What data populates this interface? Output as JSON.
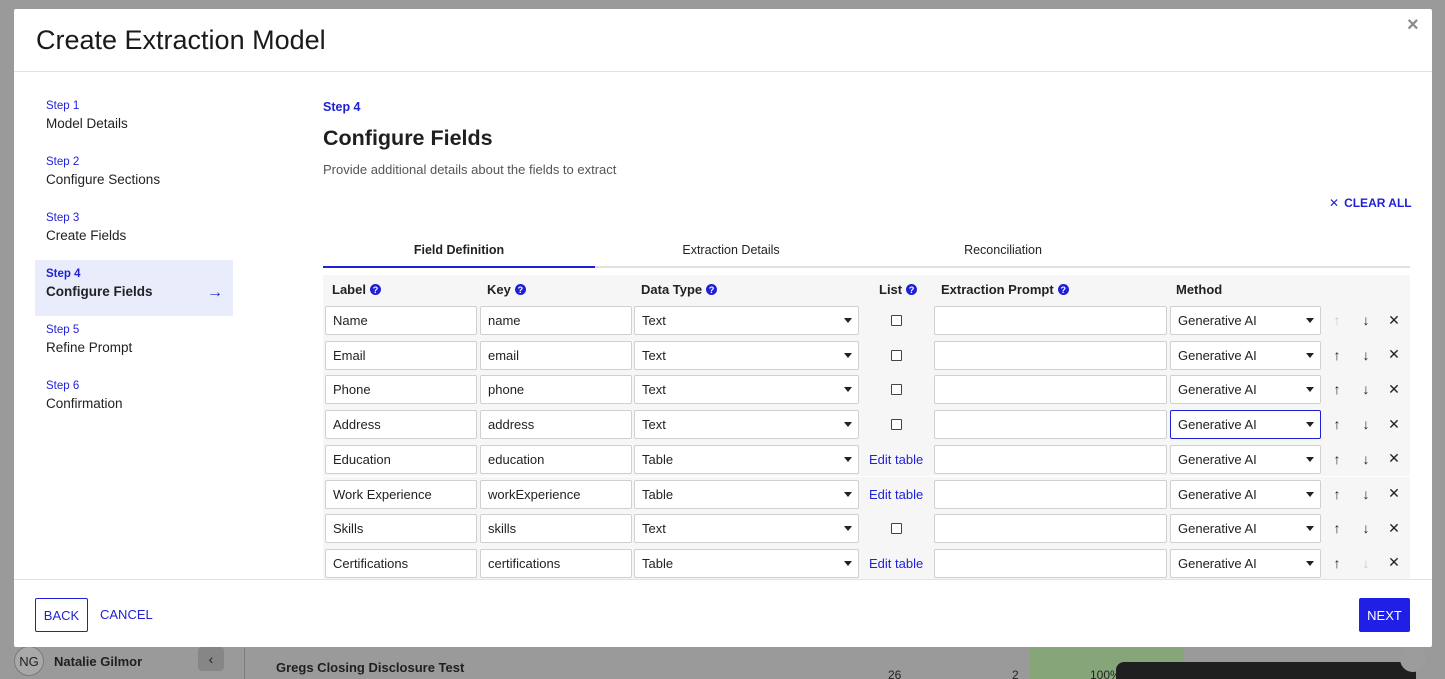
{
  "modal": {
    "title": "Create Extraction Model",
    "close_icon": "×"
  },
  "steps": [
    {
      "num": "Step 1",
      "name": "Model Details"
    },
    {
      "num": "Step 2",
      "name": "Configure Sections"
    },
    {
      "num": "Step 3",
      "name": "Create Fields"
    },
    {
      "num": "Step 4",
      "name": "Configure Fields",
      "active": true
    },
    {
      "num": "Step 5",
      "name": "Refine Prompt"
    },
    {
      "num": "Step 6",
      "name": "Confirmation"
    }
  ],
  "content": {
    "step_label": "Step 4",
    "title": "Configure Fields",
    "subtitle": "Provide additional details about the fields to extract",
    "clear_all": "CLEAR ALL"
  },
  "tabs": [
    "Field Definition",
    "Extraction Details",
    "Reconciliation"
  ],
  "table": {
    "headers": {
      "label": "Label",
      "key": "Key",
      "data_type": "Data Type",
      "list": "List",
      "prompt": "Extraction Prompt",
      "method": "Method"
    },
    "edit_table_label": "Edit table",
    "rows": [
      {
        "label": "Name",
        "key": "name",
        "type": "Text",
        "method": "Generative AI"
      },
      {
        "label": "Email",
        "key": "email",
        "type": "Text",
        "method": "Generative AI"
      },
      {
        "label": "Phone",
        "key": "phone",
        "type": "Text",
        "method": "Generative AI"
      },
      {
        "label": "Address",
        "key": "address",
        "type": "Text",
        "method": "Generative AI"
      },
      {
        "label": "Education",
        "key": "education",
        "type": "Table",
        "method": "Generative AI"
      },
      {
        "label": "Work Experience",
        "key": "workExperience",
        "type": "Table",
        "method": "Generative AI"
      },
      {
        "label": "Skills",
        "key": "skills",
        "type": "Text",
        "method": "Generative AI"
      },
      {
        "label": "Certifications",
        "key": "certifications",
        "type": "Table",
        "method": "Generative AI"
      }
    ]
  },
  "footer": {
    "back": "BACK",
    "cancel": "CANCEL",
    "next": "NEXT"
  },
  "background": {
    "user_initials": "NG",
    "user_name": "Natalie Gilmor",
    "title": "Gregs Closing Disclosure Test",
    "num1": "26",
    "num2": "2",
    "percent": "100%"
  },
  "colors": {
    "accent": "#1f1fd6",
    "overlay": "#8e8e8e"
  }
}
